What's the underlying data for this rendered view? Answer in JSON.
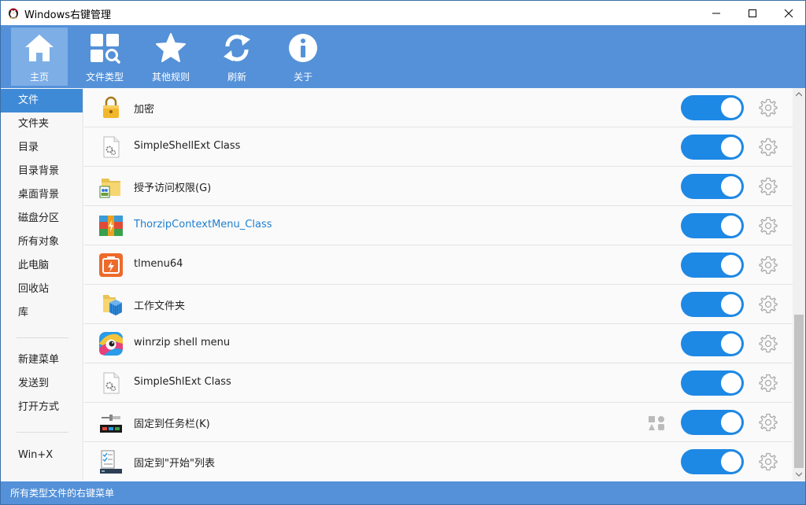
{
  "window": {
    "title": "Windows右键管理",
    "accent_color": "#5491d8",
    "toggle_color": "#1e88e5"
  },
  "toolbar": {
    "items": [
      {
        "label": "主页",
        "icon": "home-icon",
        "active": true
      },
      {
        "label": "文件类型",
        "icon": "file-types-icon",
        "active": false
      },
      {
        "label": "其他规则",
        "icon": "star-icon",
        "active": false
      },
      {
        "label": "刷新",
        "icon": "refresh-icon",
        "active": false
      },
      {
        "label": "关于",
        "icon": "info-icon",
        "active": false
      }
    ]
  },
  "sidebar": {
    "items": [
      {
        "label": "文件",
        "active": true
      },
      {
        "label": "文件夹"
      },
      {
        "label": "目录"
      },
      {
        "label": "目录背景"
      },
      {
        "label": "桌面背景"
      },
      {
        "label": "磁盘分区"
      },
      {
        "label": "所有对象"
      },
      {
        "label": "此电脑"
      },
      {
        "label": "回收站"
      },
      {
        "label": "库"
      },
      {
        "label": "新建菜单"
      },
      {
        "label": "发送到"
      },
      {
        "label": "打开方式"
      },
      {
        "label": "Win+X"
      }
    ]
  },
  "list": {
    "rows": [
      {
        "label": "加密",
        "icon": "lock-icon",
        "enabled": true
      },
      {
        "label": "SimpleShellExt Class",
        "icon": "settings-file-icon",
        "enabled": true
      },
      {
        "label": "授予访问权限(G)",
        "icon": "share-folder-icon",
        "enabled": true
      },
      {
        "label": "ThorzipContextMenu_Class",
        "icon": "thorzip-icon",
        "enabled": true,
        "link": true
      },
      {
        "label": "tlmenu64",
        "icon": "tlmenu-icon",
        "enabled": true
      },
      {
        "label": "工作文件夹",
        "icon": "work-folder-icon",
        "enabled": true
      },
      {
        "label": "winrzip shell menu",
        "icon": "winrzip-icon",
        "enabled": true
      },
      {
        "label": "SimpleShlExt Class",
        "icon": "settings-file-icon",
        "enabled": true
      },
      {
        "label": "固定到任务栏(K)",
        "icon": "pin-taskbar-icon",
        "enabled": true,
        "extra_icon": "shapes-icon"
      },
      {
        "label": "固定到\"开始\"列表",
        "icon": "pin-start-icon",
        "enabled": true
      }
    ]
  },
  "status": {
    "text": "所有类型文件的右键菜单"
  }
}
